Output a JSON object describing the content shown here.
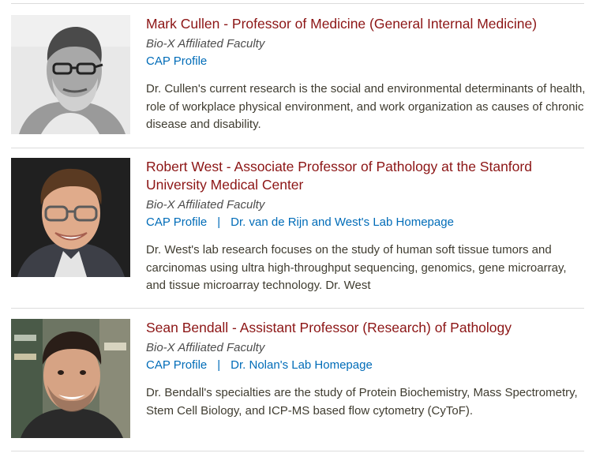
{
  "people": [
    {
      "name": "Mark Cullen - Professor of Medicine (General Internal Medicine)",
      "affiliation": "Bio-X Affiliated Faculty",
      "links": [
        "CAP Profile"
      ],
      "description": "Dr. Cullen's current research is the social and environmental determinants of health, role of workplace physical environment, and work organization as causes of chronic disease and disability."
    },
    {
      "name": "Robert West - Associate Professor of Pathology at the Stanford University Medical Center",
      "affiliation": "Bio-X Affiliated Faculty",
      "links": [
        "CAP Profile",
        "Dr. van de Rijn and West's Lab Homepage"
      ],
      "separator": "|",
      "description": "Dr. West's lab research focuses on the study of human soft tissue tumors and carcinomas using ultra high-throughput sequencing, genomics, gene microarray, and tissue microarray technology. Dr. West"
    },
    {
      "name": "Sean Bendall - Assistant Professor (Research) of Pathology",
      "affiliation": "Bio-X Affiliated Faculty",
      "links": [
        "CAP Profile",
        "Dr. Nolan's Lab Homepage"
      ],
      "separator": "|",
      "description": "Dr. Bendall's specialties are the study of Protein Biochemistry, Mass Spectrometry, Stem Cell Biology, and ICP-MS based flow cytometry (CyToF)."
    }
  ],
  "colors": {
    "name": "#8c1515",
    "link": "#006cb8",
    "text": "#3f3c30",
    "rule": "#dcdcdc"
  }
}
